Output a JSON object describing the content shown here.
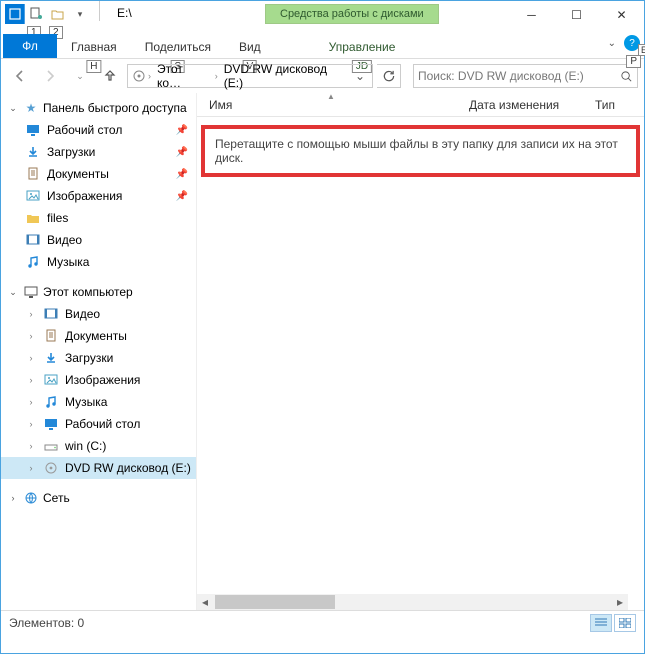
{
  "window": {
    "title": "E:\\",
    "disc_tools": "Средства работы с дисками"
  },
  "qat": {
    "key1": "1",
    "key2": "2"
  },
  "tabs": {
    "file": "Фл",
    "home": "Главная",
    "share": "Поделиться",
    "view": "Вид",
    "manage": "Управление",
    "hint_h": "H",
    "hint_s": "S",
    "hint_v": "V",
    "hint_jd": "JD"
  },
  "breadcrumb": {
    "seg1": "Этот ко…",
    "seg2": "DVD RW дисковод (E:)"
  },
  "search": {
    "placeholder": "Поиск: DVD RW дисковод (E:)",
    "hint_p": "P",
    "hint_e": "E"
  },
  "sidebar": {
    "quick": "Панель быстрого доступа",
    "thispc": "Этот компьютер",
    "network": "Сеть",
    "items_quick": [
      {
        "label": "Рабочий стол",
        "icon": "desktop",
        "pinned": true
      },
      {
        "label": "Загрузки",
        "icon": "dl",
        "pinned": true
      },
      {
        "label": "Документы",
        "icon": "doc",
        "pinned": true
      },
      {
        "label": "Изображения",
        "icon": "img",
        "pinned": true
      },
      {
        "label": "files",
        "icon": "folder",
        "pinned": false
      },
      {
        "label": "Видео",
        "icon": "video",
        "pinned": false
      },
      {
        "label": "Музыка",
        "icon": "music",
        "pinned": false
      }
    ],
    "items_pc": [
      {
        "label": "Видео",
        "icon": "video"
      },
      {
        "label": "Документы",
        "icon": "doc"
      },
      {
        "label": "Загрузки",
        "icon": "dl"
      },
      {
        "label": "Изображения",
        "icon": "img"
      },
      {
        "label": "Музыка",
        "icon": "music"
      },
      {
        "label": "Рабочий стол",
        "icon": "desktop"
      },
      {
        "label": "win (C:)",
        "icon": "drive"
      },
      {
        "label": "DVD RW дисковод (E:)",
        "icon": "dvd",
        "selected": true
      }
    ]
  },
  "columns": {
    "name": "Имя",
    "date": "Дата изменения",
    "type": "Тип"
  },
  "hint": "Перетащите с помощью мыши файлы в эту папку для записи их на этот диск.",
  "status": "Элементов: 0"
}
